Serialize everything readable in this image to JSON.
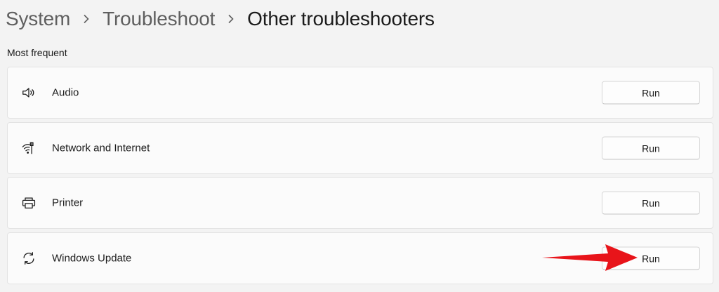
{
  "breadcrumb": {
    "items": [
      "System",
      "Troubleshoot",
      "Other troubleshooters"
    ]
  },
  "section": {
    "title": "Most frequent"
  },
  "troubleshooters": [
    {
      "label": "Audio",
      "icon": "speaker-icon",
      "button": "Run"
    },
    {
      "label": "Network and Internet",
      "icon": "network-icon",
      "button": "Run"
    },
    {
      "label": "Printer",
      "icon": "printer-icon",
      "button": "Run"
    },
    {
      "label": "Windows Update",
      "icon": "sync-icon",
      "button": "Run"
    }
  ],
  "annotation": {
    "arrow_color": "#e8141a"
  }
}
